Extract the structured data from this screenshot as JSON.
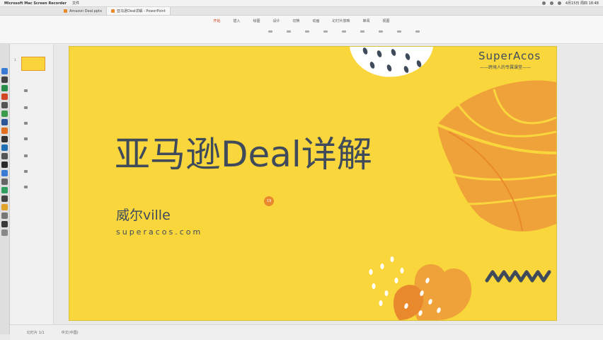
{
  "menubar": {
    "app_name": "Microsoft Mac Screen Recorder",
    "menu_1": "文件",
    "clock": "4月15日 周四 18:48"
  },
  "tabs": [
    {
      "label": "Amazon Deal.pptx"
    },
    {
      "label": "亚马逊Deal详解 - PowerPoint"
    }
  ],
  "ribbon": {
    "menus": [
      "开始",
      "插入",
      "绘图",
      "设计",
      "切换",
      "动画",
      "幻灯片放映",
      "审阅",
      "视图"
    ],
    "active_menu": "开始"
  },
  "thumbs": {
    "slide_number": "1"
  },
  "slide": {
    "title": "亚马逊Deal详解",
    "author": "威尔ville",
    "url": "superacos.com",
    "brand_name": "SuperAcos",
    "brand_tagline": "——跨境人的专属课堂——",
    "cursor_label": "19"
  },
  "colors": {
    "slide_bg": "#f9d63b",
    "text_dark": "#3f4b5b",
    "orange": "#e8892e",
    "leaf_orange": "#f0a23a",
    "white": "#ffffff"
  },
  "status": {
    "slide_info": "幻灯片 1/1",
    "language": "中文(中国)"
  }
}
